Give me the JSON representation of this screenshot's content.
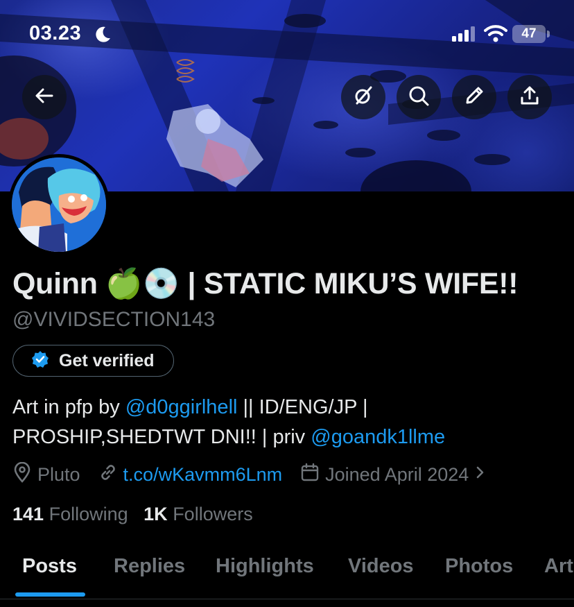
{
  "status_bar": {
    "time": "03.23",
    "battery": "47"
  },
  "profile": {
    "display_name": "Quinn 🍏💿 | STATIC MIKU’S WIFE!!",
    "handle": "@VIVIDSECTION143",
    "verify_button": "Get verified",
    "bio": {
      "part1": "Art in pfp by ",
      "mention1": "@d0ggirlhell",
      "part2": " || ID/ENG/JP |",
      "part3": "PROSHIP,SHEDTWT DNI!! | priv ",
      "mention2": "@goandk1llme"
    },
    "location": "Pluto",
    "link": "t.co/wKavmm6Lnm",
    "joined": "Joined April 2024",
    "following_count": "141",
    "following_label": "Following",
    "followers_count": "1K",
    "followers_label": "Followers"
  },
  "tabs": [
    {
      "label": "Posts",
      "active": true
    },
    {
      "label": "Replies",
      "active": false
    },
    {
      "label": "Highlights",
      "active": false
    },
    {
      "label": "Videos",
      "active": false
    },
    {
      "label": "Photos",
      "active": false
    },
    {
      "label": "Art",
      "active": false
    }
  ],
  "colors": {
    "accent": "#1d9bf0",
    "text_primary": "#e7e9ea",
    "text_secondary": "#71767b",
    "background": "#000000"
  },
  "icons": {
    "back": "arrow-left-icon",
    "grok": "grok-icon",
    "search": "search-icon",
    "edit": "pencil-icon",
    "share": "share-icon",
    "verified": "verified-badge-icon",
    "location": "location-pin-icon",
    "link": "link-icon",
    "calendar": "calendar-icon"
  }
}
